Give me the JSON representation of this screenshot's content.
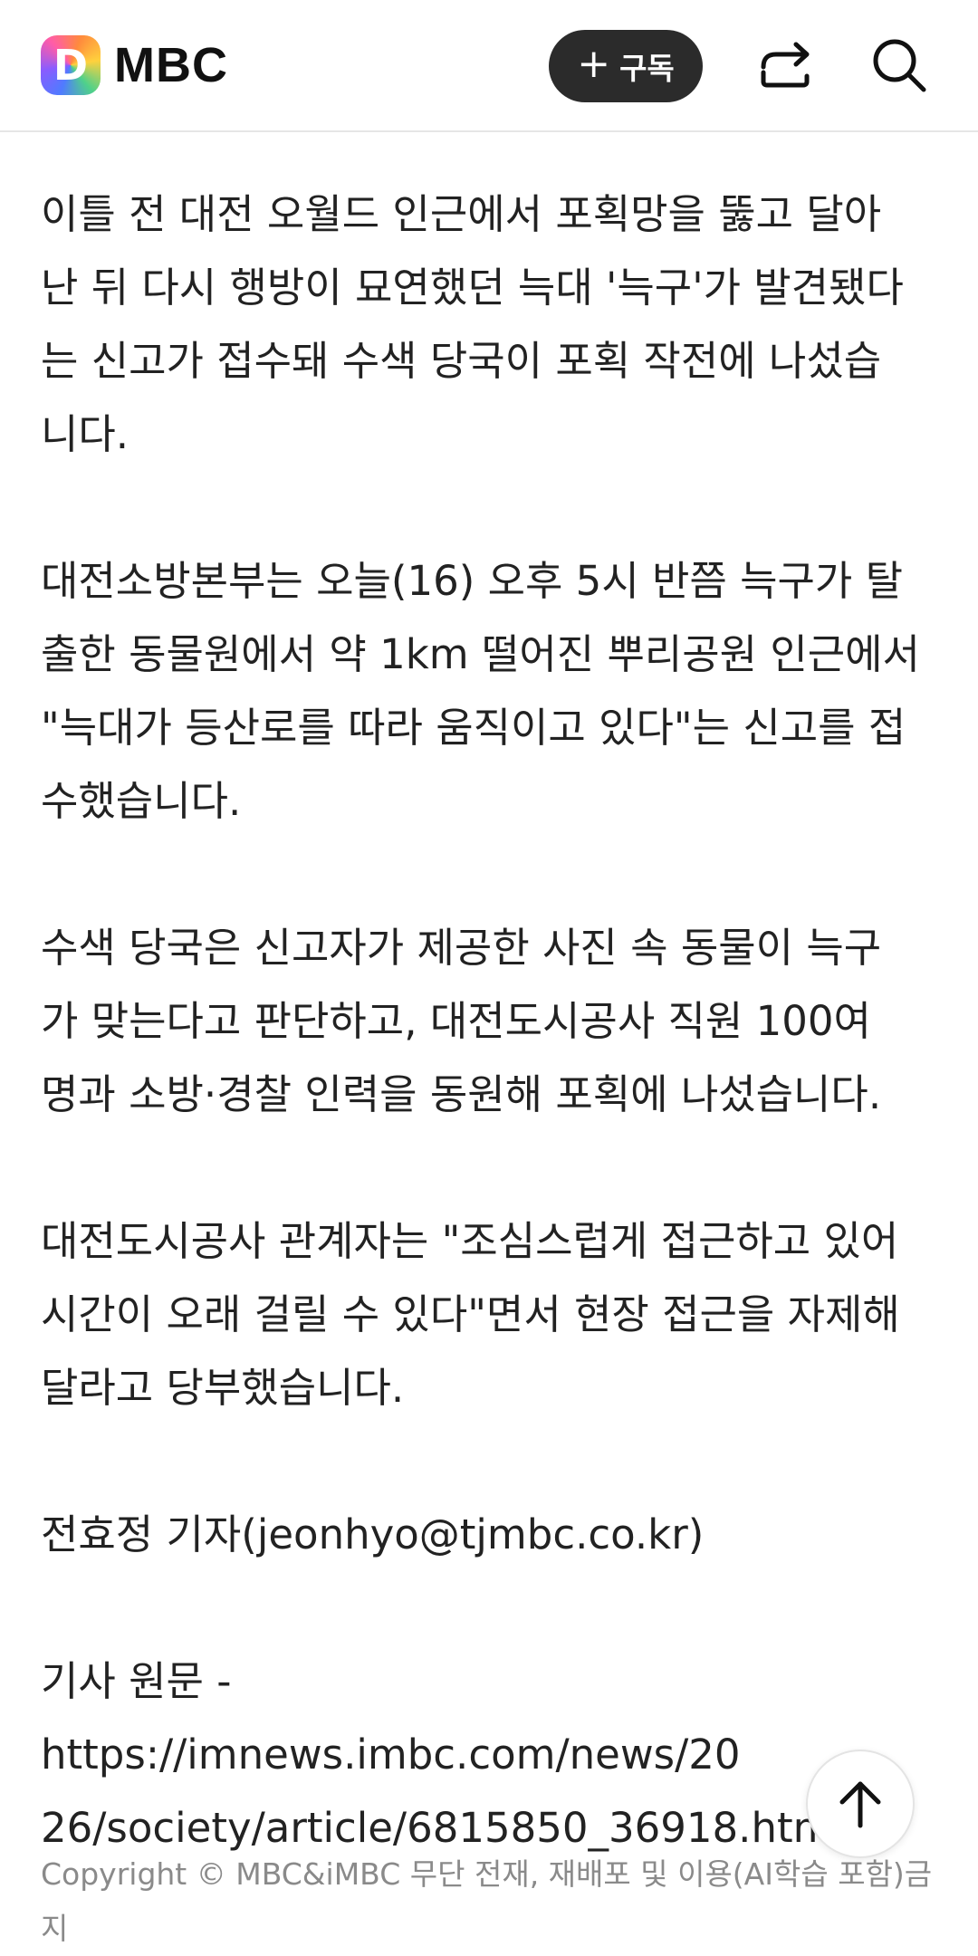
{
  "header": {
    "logo_letter": "D",
    "brand": "MBC",
    "subscribe_label": "구독",
    "subscribe_plus": "+"
  },
  "article": {
    "paragraphs": [
      "이틀 전 대전 오월드 인근에서 포획망을 뚫고 달아\n난 뒤 다시 행방이 묘연했던 늑대 '늑구'가 발견됐다\n는 신고가 접수돼 수색 당국이 포획 작전에 나섰습\n니다.",
      "대전소방본부는 오늘(16) 오후 5시 반쯤 늑구가 탈\n출한 동물원에서 약 1km 떨어진 뿌리공원 인근에서\n\"늑대가 등산로를 따라 움직이고 있다\"는 신고를 접\n수했습니다.",
      "수색 당국은 신고자가 제공한 사진 속 동물이 늑구\n가 맞는다고 판단하고, 대전도시공사 직원 100여\n명과 소방·경찰 인력을 동원해 포획에 나섰습니다.",
      "대전도시공사 관계자는 \"조심스럽게 접근하고 있어\n시간이 오래 걸릴 수 있다\"면서 현장 접근을 자제해\n달라고 당부했습니다.",
      "전효정 기자(jeonhyo@tjmbc.co.kr)",
      "기사 원문 - https://imnews.imbc.com/news/20\n26/society/article/6815850_36918.html"
    ]
  },
  "footer": {
    "copyright": "Copyright © MBC&iMBC 무단 전재, 재배포 및 이용(AI학습 포함)금\n지"
  },
  "icons": {
    "share": "share-icon",
    "search": "search-icon",
    "scroll_top": "arrow-up-icon"
  }
}
